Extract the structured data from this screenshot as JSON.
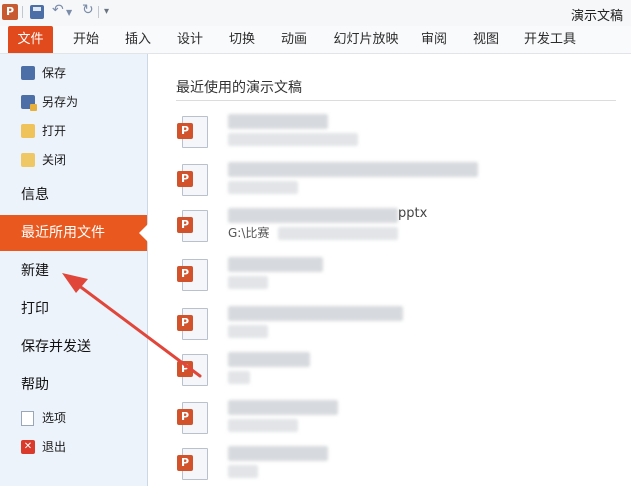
{
  "app": {
    "icon_letter": "P",
    "window_title": "演示文稿"
  },
  "quick_access": {
    "undo_icon": "undo-icon",
    "redo_icon": "redo-icon",
    "save_icon": "save-icon"
  },
  "tabs": [
    "文件",
    "开始",
    "插入",
    "设计",
    "切换",
    "动画",
    "幻灯片放映",
    "审阅",
    "视图",
    "开发工具"
  ],
  "nav": {
    "save": "保存",
    "save_as": "另存为",
    "open": "打开",
    "close": "关闭",
    "info": "信息",
    "recent": "最近所用文件",
    "new": "新建",
    "print": "打印",
    "save_send": "保存并发送",
    "help": "帮助",
    "options": "选项",
    "exit": "退出"
  },
  "main": {
    "section_title": "最近使用的演示文稿",
    "visible_fragments": {
      "name_suffix": "pptx",
      "path_prefix": "G:\\比赛"
    }
  },
  "colors": {
    "accent": "#e9591f",
    "file_tab": "#e04a1c",
    "nav_bg": "#edf3fb",
    "arrow": "#e0463a"
  }
}
